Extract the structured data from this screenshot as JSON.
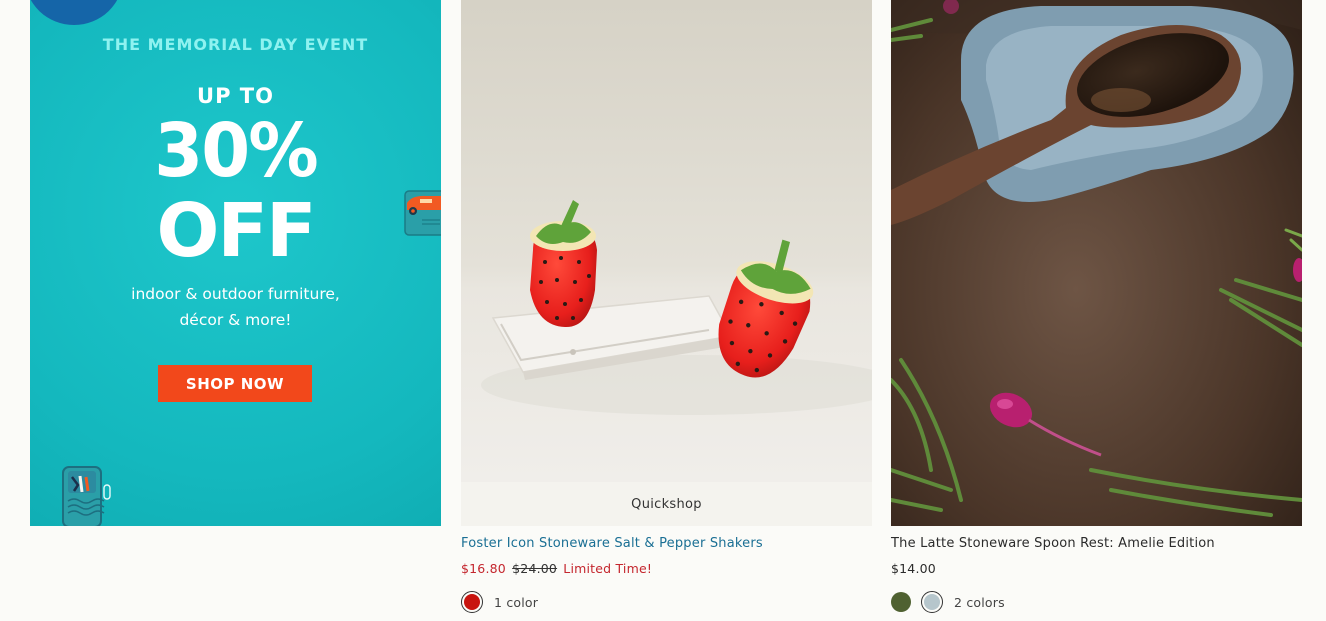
{
  "promo": {
    "eyebrow": "THE MEMORIAL DAY EVENT",
    "up_to": "UP TO",
    "discount": "30%",
    "off": "OFF",
    "subtext_line1": "indoor & outdoor furniture,",
    "subtext_line2": "décor & more!",
    "cta": "SHOP NOW",
    "colors": {
      "background": "#14b8be",
      "cta": "#f2481b",
      "eyebrow": "#8ff2f0"
    }
  },
  "products": [
    {
      "quickshop_label": "Quickshop",
      "title": "Foster Icon Stoneware Salt & Pepper Shakers",
      "sale_price": "$16.80",
      "original_price": "$24.00",
      "promo_note": "Limited Time!",
      "swatches": [
        "#c8140f"
      ],
      "colors_label": "1 color",
      "title_color": "#1a6f94",
      "sale_color": "#c4262e"
    },
    {
      "title": "The Latte Stoneware Spoon Rest: Amelie Edition",
      "price": "$14.00",
      "swatches": [
        "#4f6131",
        "#b6c6cc"
      ],
      "colors_label": "2 colors"
    }
  ]
}
